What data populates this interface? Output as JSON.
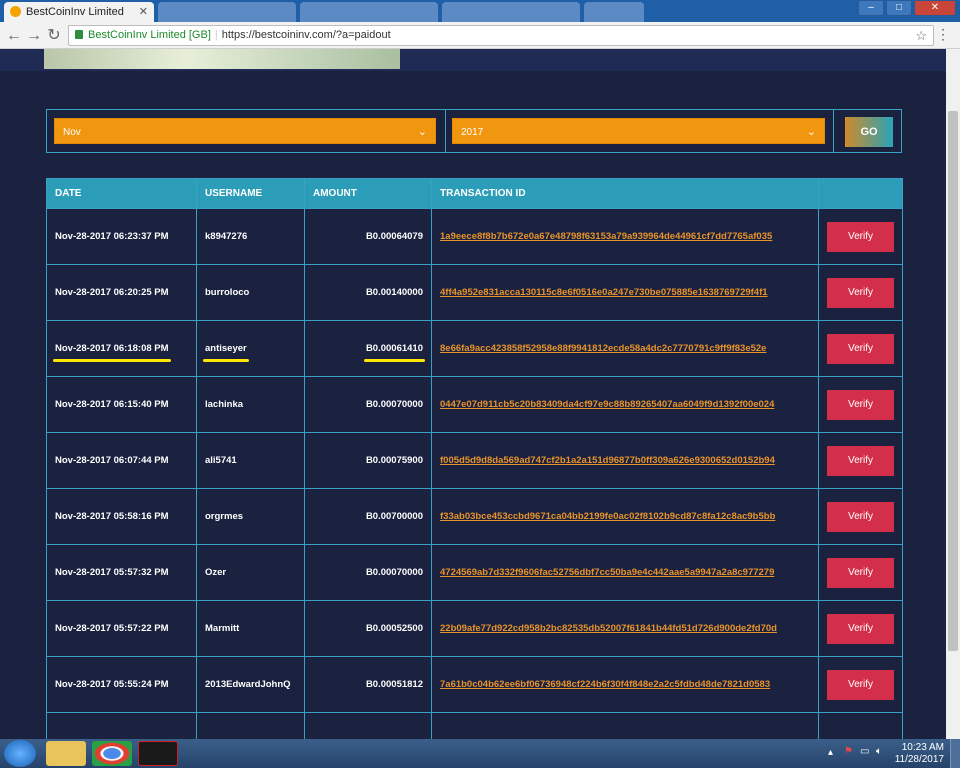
{
  "browser": {
    "active_tab_title": "BestCoinInv Limited",
    "inactive_tabs": [
      "",
      "",
      "",
      ""
    ],
    "site_identity": "BestCoinInv Limited [GB]",
    "url": "https://bestcoininv.com/?a=paidout"
  },
  "filter": {
    "month": "Nov",
    "year": "2017",
    "go_label": "GO"
  },
  "table": {
    "headers": [
      "DATE",
      "USERNAME",
      "AMOUNT",
      "TRANSACTION ID",
      ""
    ],
    "verify_label": "Verify",
    "rows": [
      {
        "date": "Nov-28-2017 06:23:37 PM",
        "username": "k8947276",
        "amount": "B0.00064079",
        "txid": "1a9eece8f8b7b672e0a67e48798f63153a79a939964de44961cf7dd7765af035"
      },
      {
        "date": "Nov-28-2017 06:20:25 PM",
        "username": "burroloco",
        "amount": "B0.00140000",
        "txid": "4ff4a952e831acca130115c8e6f0516e0a247e730be075885e1638769729f4f1"
      },
      {
        "date": "Nov-28-2017 06:18:08 PM",
        "username": "antiseyer",
        "amount": "B0.00061410",
        "txid": "8e66fa9acc423858f52958e88f9941812ecde58a4dc2c7770791c9ff9f83e52e"
      },
      {
        "date": "Nov-28-2017 06:15:40 PM",
        "username": "lachinka",
        "amount": "B0.00070000",
        "txid": "0447e07d911cb5c20b83409da4cf97e9c88b89265407aa6049f9d1392f00e024"
      },
      {
        "date": "Nov-28-2017 06:07:44 PM",
        "username": "ali5741",
        "amount": "B0.00075900",
        "txid": "f005d5d9d8da569ad747cf2b1a2a151d96877b0ff309a626e9300652d0152b94"
      },
      {
        "date": "Nov-28-2017 05:58:16 PM",
        "username": "orgrmes",
        "amount": "B0.00700000",
        "txid": "f33ab03bce453ccbd9671ca04bb2199fe0ac02f8102b9cd87c8fa12c8ac9b5bb"
      },
      {
        "date": "Nov-28-2017 05:57:32 PM",
        "username": "Ozer",
        "amount": "B0.00070000",
        "txid": "4724569ab7d332f9606fac52756dbf7cc50ba9e4c442aae5a9947a2a8c977279"
      },
      {
        "date": "Nov-28-2017 05:57:22 PM",
        "username": "Marmitt",
        "amount": "B0.00052500",
        "txid": "22b09afe77d922cd958b2bc82535db52007f61841b44fd51d726d900de2fd70d"
      },
      {
        "date": "Nov-28-2017 05:55:24 PM",
        "username": "2013EdwardJohnQ",
        "amount": "B0.00051812",
        "txid": "7a61b0c04b62ee6bf06736948cf224b6f30f4f848e2a2c5fdbd48de7821d0583"
      }
    ]
  },
  "taskbar": {
    "time": "10:23 AM",
    "date": "11/28/2017"
  },
  "colors": {
    "page_bg": "#1b2240",
    "header_bg": "#2b9db9",
    "select_bg": "#f0960f",
    "verify_bg": "#d42f4a",
    "txid_color": "#e8932a",
    "highlight": "#ffe600"
  }
}
